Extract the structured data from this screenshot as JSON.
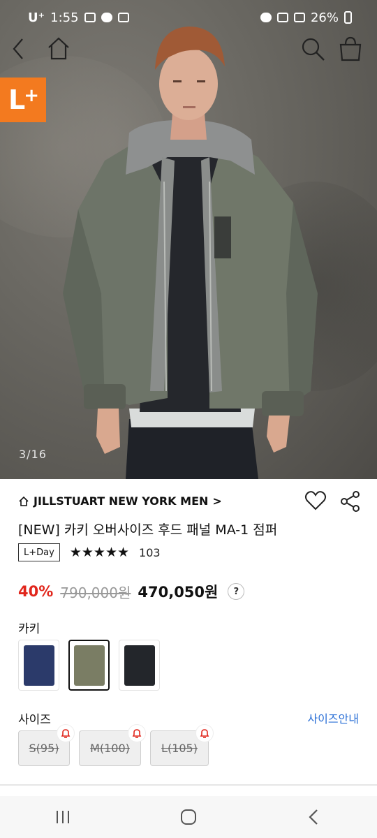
{
  "status_bar": {
    "carrier": "U⁺",
    "time": "1:55",
    "battery": "26%"
  },
  "hero": {
    "badge": "L",
    "badge_sup": "+",
    "counter": "3/16"
  },
  "product": {
    "brand": "JILLSTUART NEW YORK MEN",
    "brand_arrow": ">",
    "title": "[NEW] 카키 오버사이즈 후드 패널 MA-1 점퍼",
    "tag": "L+Day",
    "rating_stars": 5,
    "review_count": "103",
    "discount": "40%",
    "original_price": "790,000원",
    "sale_price": "470,050원",
    "help": "?"
  },
  "options": {
    "color_label": "카키",
    "swatches": [
      {
        "color": "#2b3a6a",
        "selected": false
      },
      {
        "color": "#7a7d64",
        "selected": true
      },
      {
        "color": "#23262b",
        "selected": false
      }
    ],
    "size_label": "사이즈",
    "size_guide": "사이즈안내",
    "sizes": [
      "S(95)",
      "M(100)",
      "L(105)"
    ]
  },
  "colors": {
    "discount": "#e1261c",
    "badge": "#f37a1f",
    "link": "#2a6fd6"
  }
}
